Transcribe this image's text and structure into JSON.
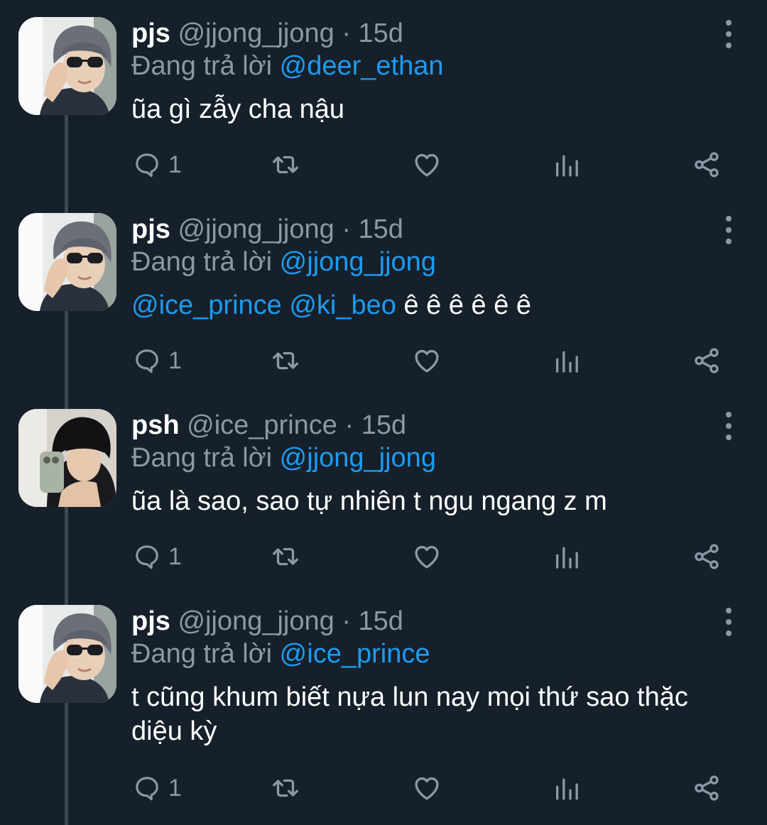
{
  "tweets": [
    {
      "name": "pjs",
      "handle": "@jjong_jjong",
      "time": "15d",
      "replying_label": "Đang trả lời",
      "replying_to": "@deer_ethan",
      "mentions": "",
      "text": "ũa gì zẫy cha nậu",
      "reply_count": "1",
      "avatar": "sunglasses-person"
    },
    {
      "name": "pjs",
      "handle": "@jjong_jjong",
      "time": "15d",
      "replying_label": "Đang trả lời",
      "replying_to": "@jjong_jjong",
      "mentions": "@ice_prince @ki_beo",
      "text": " ê ê ê ê ê ê",
      "reply_count": "1",
      "avatar": "sunglasses-person"
    },
    {
      "name": "psh",
      "handle": "@ice_prince",
      "time": "15d",
      "replying_label": "Đang trả lời",
      "replying_to": "@jjong_jjong",
      "mentions": "",
      "text": "ũa là sao, sao tự nhiên t ngu ngang z m",
      "reply_count": "1",
      "avatar": "mirror-selfie-person"
    },
    {
      "name": "pjs",
      "handle": "@jjong_jjong",
      "time": "15d",
      "replying_label": "Đang trả lời",
      "replying_to": "@ice_prince",
      "mentions": "",
      "text": "t cũng khum biết nựa lun nay mọi thứ sao thặc diệu kỳ",
      "reply_count": "1",
      "avatar": "sunglasses-person"
    }
  ],
  "separator": "·",
  "icons": [
    "reply-icon",
    "retweet-icon",
    "like-icon",
    "views-icon",
    "share-icon",
    "more-options-icon"
  ],
  "colors": {
    "background": "#16202b",
    "muted": "#8b98a5",
    "link": "#1d9bf0",
    "text": "#ffffff"
  }
}
